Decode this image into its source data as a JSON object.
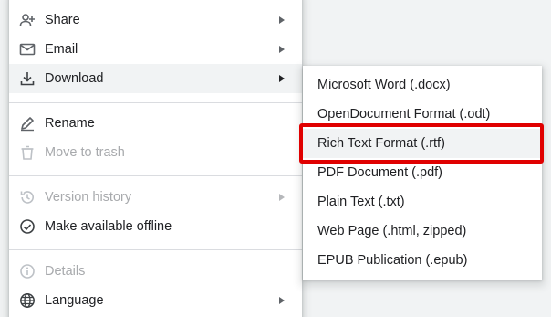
{
  "menu": {
    "items": [
      {
        "label": "Share",
        "icon": "share-icon",
        "has_submenu": true,
        "disabled": false
      },
      {
        "label": "Email",
        "icon": "email-icon",
        "has_submenu": true,
        "disabled": false
      },
      {
        "label": "Download",
        "icon": "download-icon",
        "has_submenu": true,
        "disabled": false,
        "active": true
      },
      {
        "label": "Rename",
        "icon": "rename-pencil-icon",
        "has_submenu": false,
        "disabled": false
      },
      {
        "label": "Move to trash",
        "icon": "trash-icon",
        "has_submenu": false,
        "disabled": true
      },
      {
        "label": "Version history",
        "icon": "history-icon",
        "has_submenu": true,
        "disabled": true
      },
      {
        "label": "Make available offline",
        "icon": "offline-check-icon",
        "has_submenu": false,
        "disabled": false
      },
      {
        "label": "Details",
        "icon": "info-icon",
        "has_submenu": false,
        "disabled": true
      },
      {
        "label": "Language",
        "icon": "globe-icon",
        "has_submenu": true,
        "disabled": false
      }
    ]
  },
  "download_submenu": {
    "items": [
      {
        "label": "Microsoft Word (.docx)"
      },
      {
        "label": "OpenDocument Format (.odt)"
      },
      {
        "label": "Rich Text Format (.rtf)",
        "highlighted": true
      },
      {
        "label": "PDF Document (.pdf)"
      },
      {
        "label": "Plain Text (.txt)"
      },
      {
        "label": "Web Page (.html, zipped)"
      },
      {
        "label": "EPUB Publication (.epub)"
      }
    ]
  },
  "colors": {
    "highlight_box": "#e00000",
    "active_row_bg": "#f1f3f4",
    "text": "#202124",
    "disabled_text": "#a8aaad"
  }
}
